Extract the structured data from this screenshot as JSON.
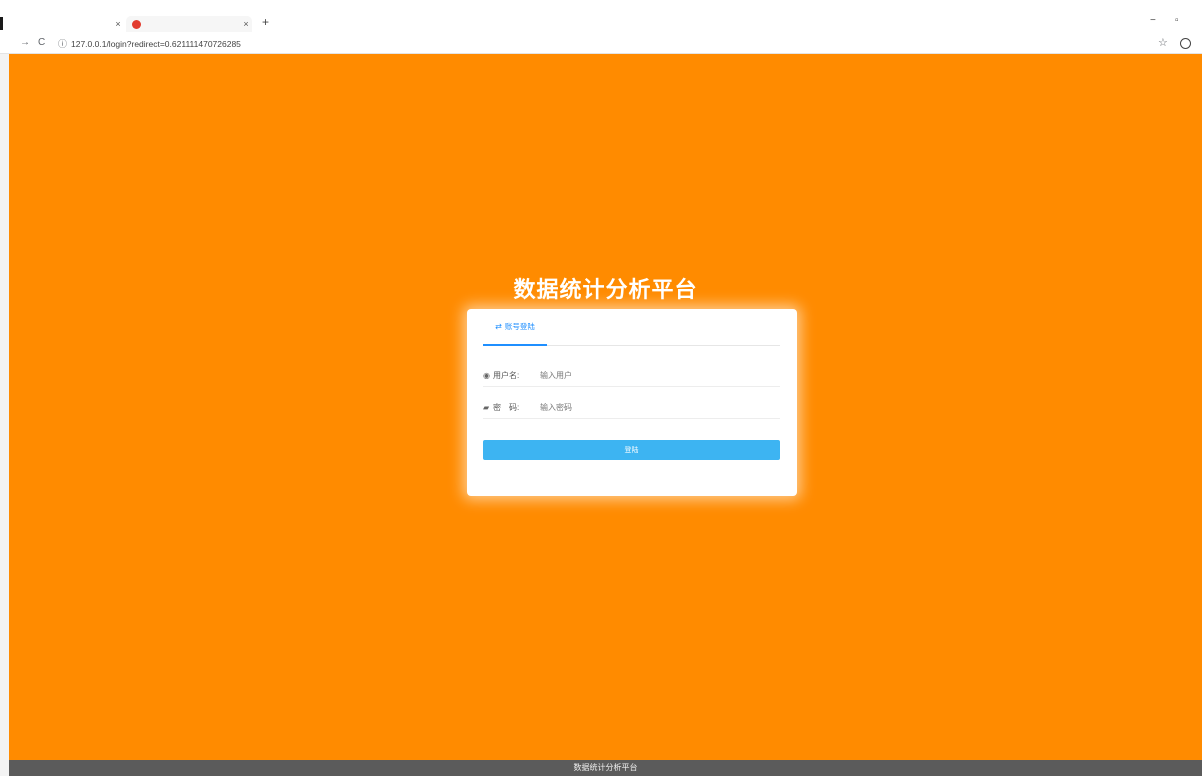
{
  "browser": {
    "tabs": [
      {
        "title": "",
        "close": "×"
      },
      {
        "title": "",
        "close": "×"
      }
    ],
    "new_tab": "+",
    "window_controls": {
      "minimize": "−",
      "maximize": "▫"
    },
    "nav": {
      "back": "→",
      "reload": "C"
    },
    "info_icon": "ⓘ",
    "url": "127.0.0.1/login?redirect=0.621111470726285",
    "bookmark_icon": "☆"
  },
  "page": {
    "title": "数据统计分析平台",
    "login_form": {
      "tab_label": "账号登陆",
      "username": {
        "label": "用户名:",
        "placeholder": "输入用户"
      },
      "password": {
        "label": "密　码:",
        "placeholder": "输入密码"
      },
      "submit_label": "登陆"
    },
    "footer_text": "数据统计分析平台"
  },
  "icons": {
    "swap": "⇄",
    "user": "◉",
    "lock": "▰"
  },
  "colors": {
    "background": "#ff8b00",
    "button": "#3db4f2",
    "accent": "#1f8fff",
    "footer": "#5b5b5b"
  }
}
